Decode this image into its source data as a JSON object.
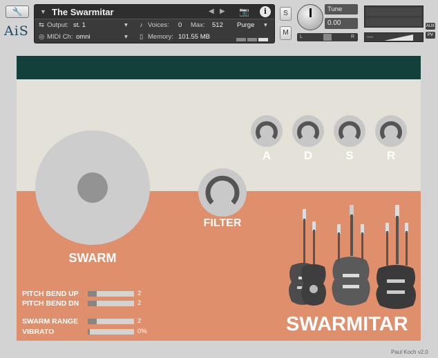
{
  "header": {
    "title": "The Swarmitar",
    "output_label": "Output:",
    "output_value": "st. 1",
    "voices_label": "Voices:",
    "voices_value": "0",
    "max_label": "Max:",
    "max_value": "512",
    "purge_label": "Purge",
    "midi_label": "MIDI Ch:",
    "midi_value": "omni",
    "memory_label": "Memory:",
    "memory_value": "101.55 MB",
    "solo_label": "S",
    "mute_label": "M",
    "tune_label": "Tune",
    "tune_value": "0.00",
    "pan_left": "L",
    "pan_right": "R",
    "aux_label": "AUX",
    "pv_label": "PV",
    "logo_text": "AiS"
  },
  "envelope": {
    "labels": [
      "A",
      "D",
      "S",
      "R"
    ]
  },
  "main": {
    "swarm_label": "SWARM",
    "filter_label": "FILTER",
    "brand": "SWARMITAR",
    "credit": "Paul Koch v2.0"
  },
  "params": [
    {
      "label": "PITCH BEND UP",
      "value": "2",
      "fill": 0.2
    },
    {
      "label": "PITCH BEND DN",
      "value": "2",
      "fill": 0.2
    },
    {
      "label": "SWARM RANGE",
      "value": "2",
      "fill": 0.2
    },
    {
      "label": "VIBRATO",
      "value": "0%",
      "fill": 0.05
    }
  ],
  "colors": {
    "top_bar": "#13403b",
    "cream": "#e3e1d8",
    "orange": "#e08f6d",
    "knob_grey": "#c7c7c7",
    "knob_arc": "#555555"
  },
  "icons": {
    "wrench": "wrench-icon",
    "camera": "camera-icon",
    "info": "info-icon"
  }
}
